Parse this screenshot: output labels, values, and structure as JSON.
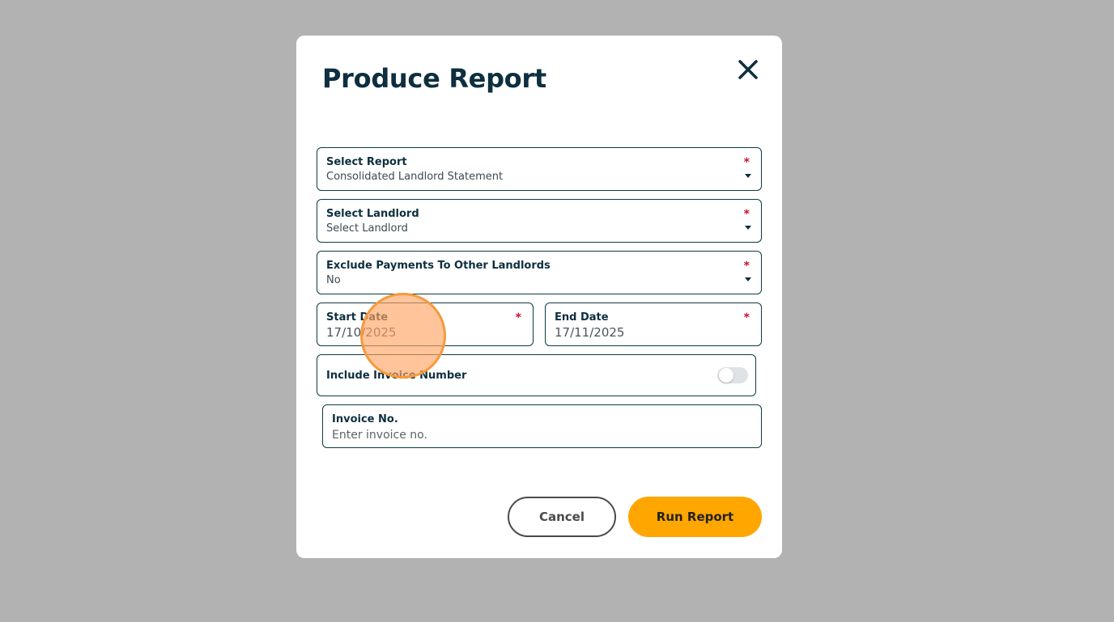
{
  "modal": {
    "title": "Produce Report",
    "close_icon": "close-icon"
  },
  "fields": {
    "select_report": {
      "label": "Select Report",
      "value": "Consolidated Landlord Statement",
      "required_marker": "*"
    },
    "select_landlord": {
      "label": "Select Landlord",
      "value": "Select Landlord",
      "required_marker": "*"
    },
    "exclude_payments": {
      "label": "Exclude Payments To Other Landlords",
      "value": "No",
      "required_marker": "*"
    },
    "start_date": {
      "label": "Start Date",
      "value": "17/10/2025",
      "required_marker": "*"
    },
    "end_date": {
      "label": "End Date",
      "value": "17/11/2025",
      "required_marker": "*"
    },
    "include_invoice_number": {
      "label": "Include Invoice Number",
      "enabled": false
    },
    "invoice_no": {
      "label": "Invoice No.",
      "placeholder": "Enter invoice no.",
      "value": ""
    }
  },
  "buttons": {
    "cancel_label": "Cancel",
    "run_report_label": "Run Report"
  },
  "colors": {
    "backdrop": "#b2b2b2",
    "title": "#0d2f3f",
    "border": "#0d3b44",
    "required": "#c8102e",
    "primary_button": "#ffa600",
    "click_indicator": "#f59a3c"
  }
}
